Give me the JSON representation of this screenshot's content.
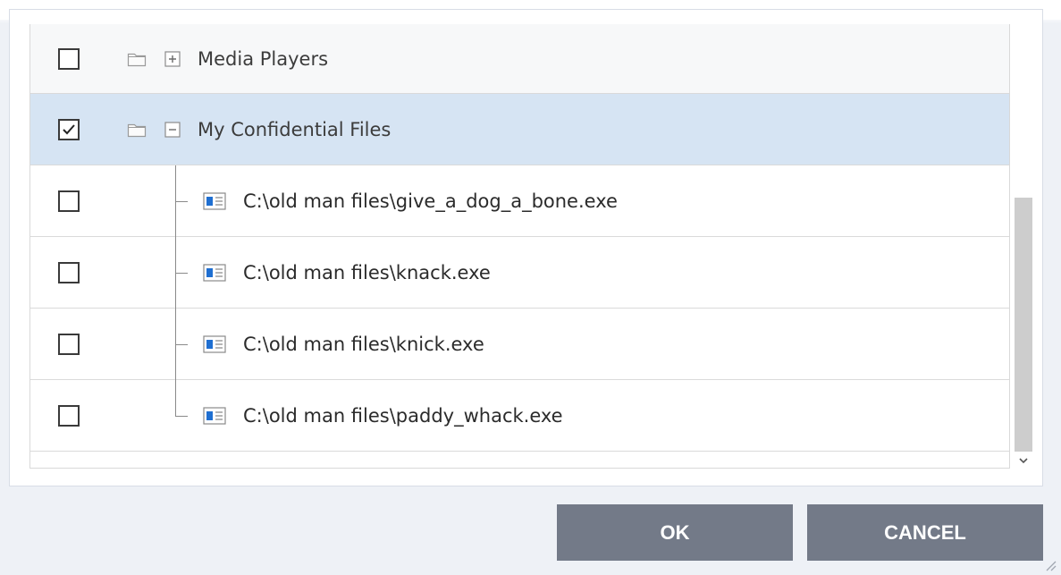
{
  "tree": {
    "groups": [
      {
        "label": "Media Players",
        "expanded": false,
        "checked": false
      },
      {
        "label": "My Confidential Files",
        "expanded": true,
        "checked": true,
        "selected": true
      }
    ],
    "files": [
      {
        "path": "C:\\old man files\\give_a_dog_a_bone.exe",
        "checked": false
      },
      {
        "path": "C:\\old man files\\knack.exe",
        "checked": false
      },
      {
        "path": "C:\\old man files\\knick.exe",
        "checked": false
      },
      {
        "path": "C:\\old man files\\paddy_whack.exe",
        "checked": false
      }
    ]
  },
  "buttons": {
    "ok_label": "OK",
    "cancel_label": "CANCEL"
  },
  "colors": {
    "selected_row": "#d6e4f3",
    "button_bg": "#737a88",
    "button_text": "#ffffff",
    "scroll_thumb": "#cdcdcd"
  },
  "icons": {
    "folder": "folder-icon",
    "expand": "plus-box-icon",
    "collapse": "minus-box-icon",
    "file": "application-file-icon",
    "check": "checkmark-icon",
    "scroll_down": "chevron-down-icon",
    "resize": "resize-grip-icon"
  }
}
